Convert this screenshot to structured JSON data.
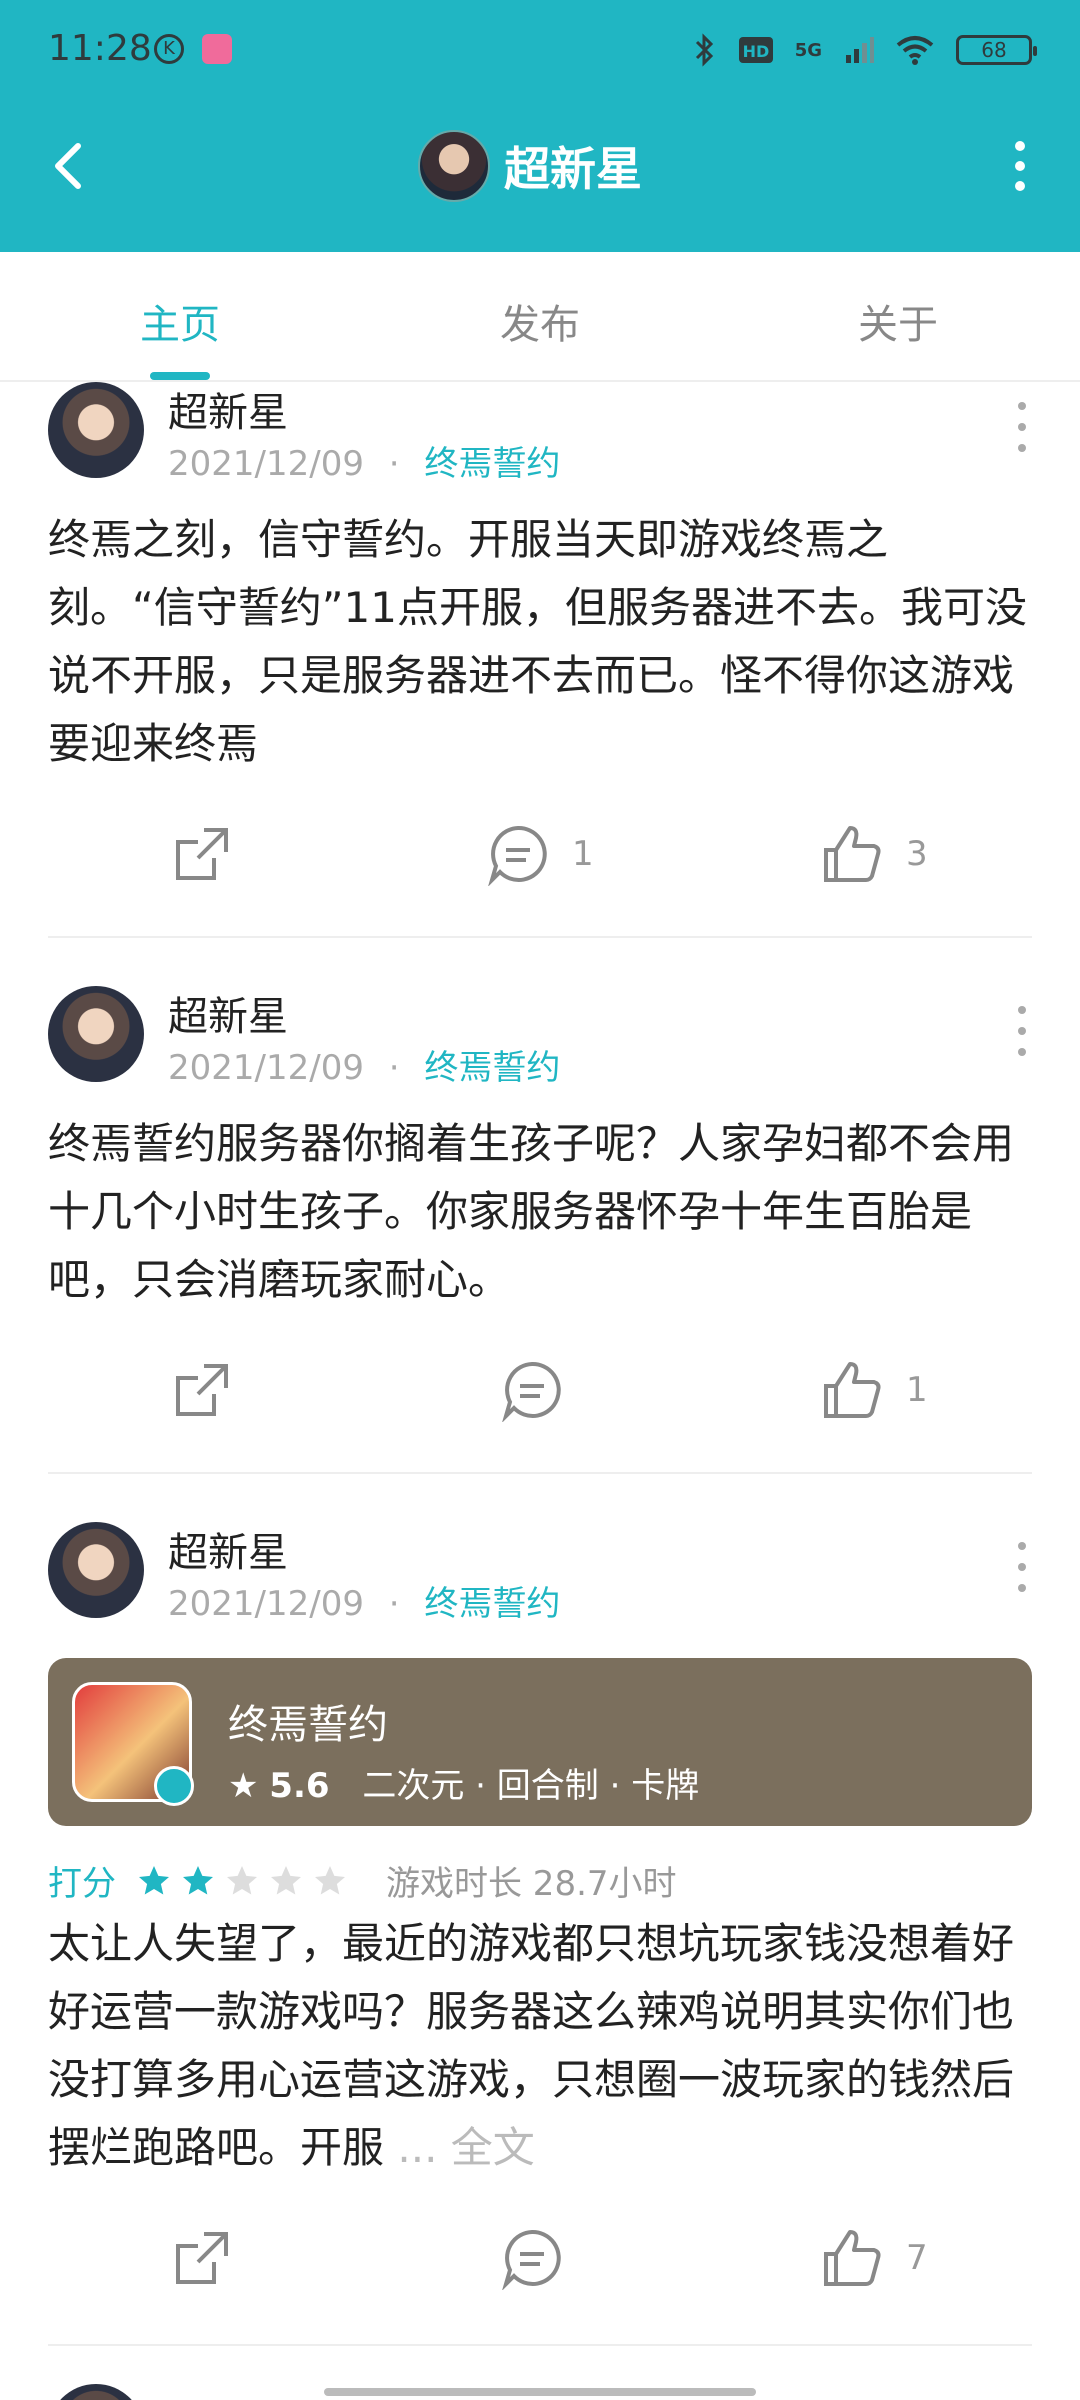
{
  "status_bar": {
    "time": "11:28",
    "network": "5G",
    "battery": "68"
  },
  "header": {
    "title": "超新星"
  },
  "tabs": [
    {
      "label": "主页",
      "active": true
    },
    {
      "label": "发布",
      "active": false
    },
    {
      "label": "关于",
      "active": false
    }
  ],
  "posts": [
    {
      "author": "超新星",
      "date": "2021/12/09",
      "separator": "·",
      "game": "终焉誓约",
      "text": "终焉之刻，信守誓约。开服当天即游戏终焉之刻。“信守誓约”11点开服，但服务器进不去。我可没说不开服，只是服务器进不去而已。怪不得你这游戏要迎来终焉",
      "comments": "1",
      "likes": "3"
    },
    {
      "author": "超新星",
      "date": "2021/12/09",
      "separator": "·",
      "game": "终焉誓约",
      "text": "终焉誓约服务器你搁着生孩子呢？人家孕妇都不会用十几个小时生孩子。你家服务器怀孕十年生百胎是吧，只会消磨玩家耐心。",
      "comments": "",
      "likes": "1"
    },
    {
      "author": "超新星",
      "date": "2021/12/09",
      "separator": "·",
      "game": "终焉誓约",
      "game_card": {
        "name": "终焉誓约",
        "score": "5.6",
        "tags": "二次元 · 回合制 · 卡牌"
      },
      "rating_label": "打分",
      "rating_stars": 2,
      "rating_max": 5,
      "playtime": "游戏时长 28.7小时",
      "text": "太让人失望了，最近的游戏都只想坑玩家钱没想着好好运营一款游戏吗？服务器这么辣鸡说明其实你们也没打算多用心运营这游戏，只想圈一波玩家的钱然后摆烂跑路吧。开服",
      "more_label": "... 全文",
      "comments": "",
      "likes": "7"
    }
  ],
  "colors": {
    "accent": "#20b6c3",
    "card_bg": "#7b6f5d"
  }
}
